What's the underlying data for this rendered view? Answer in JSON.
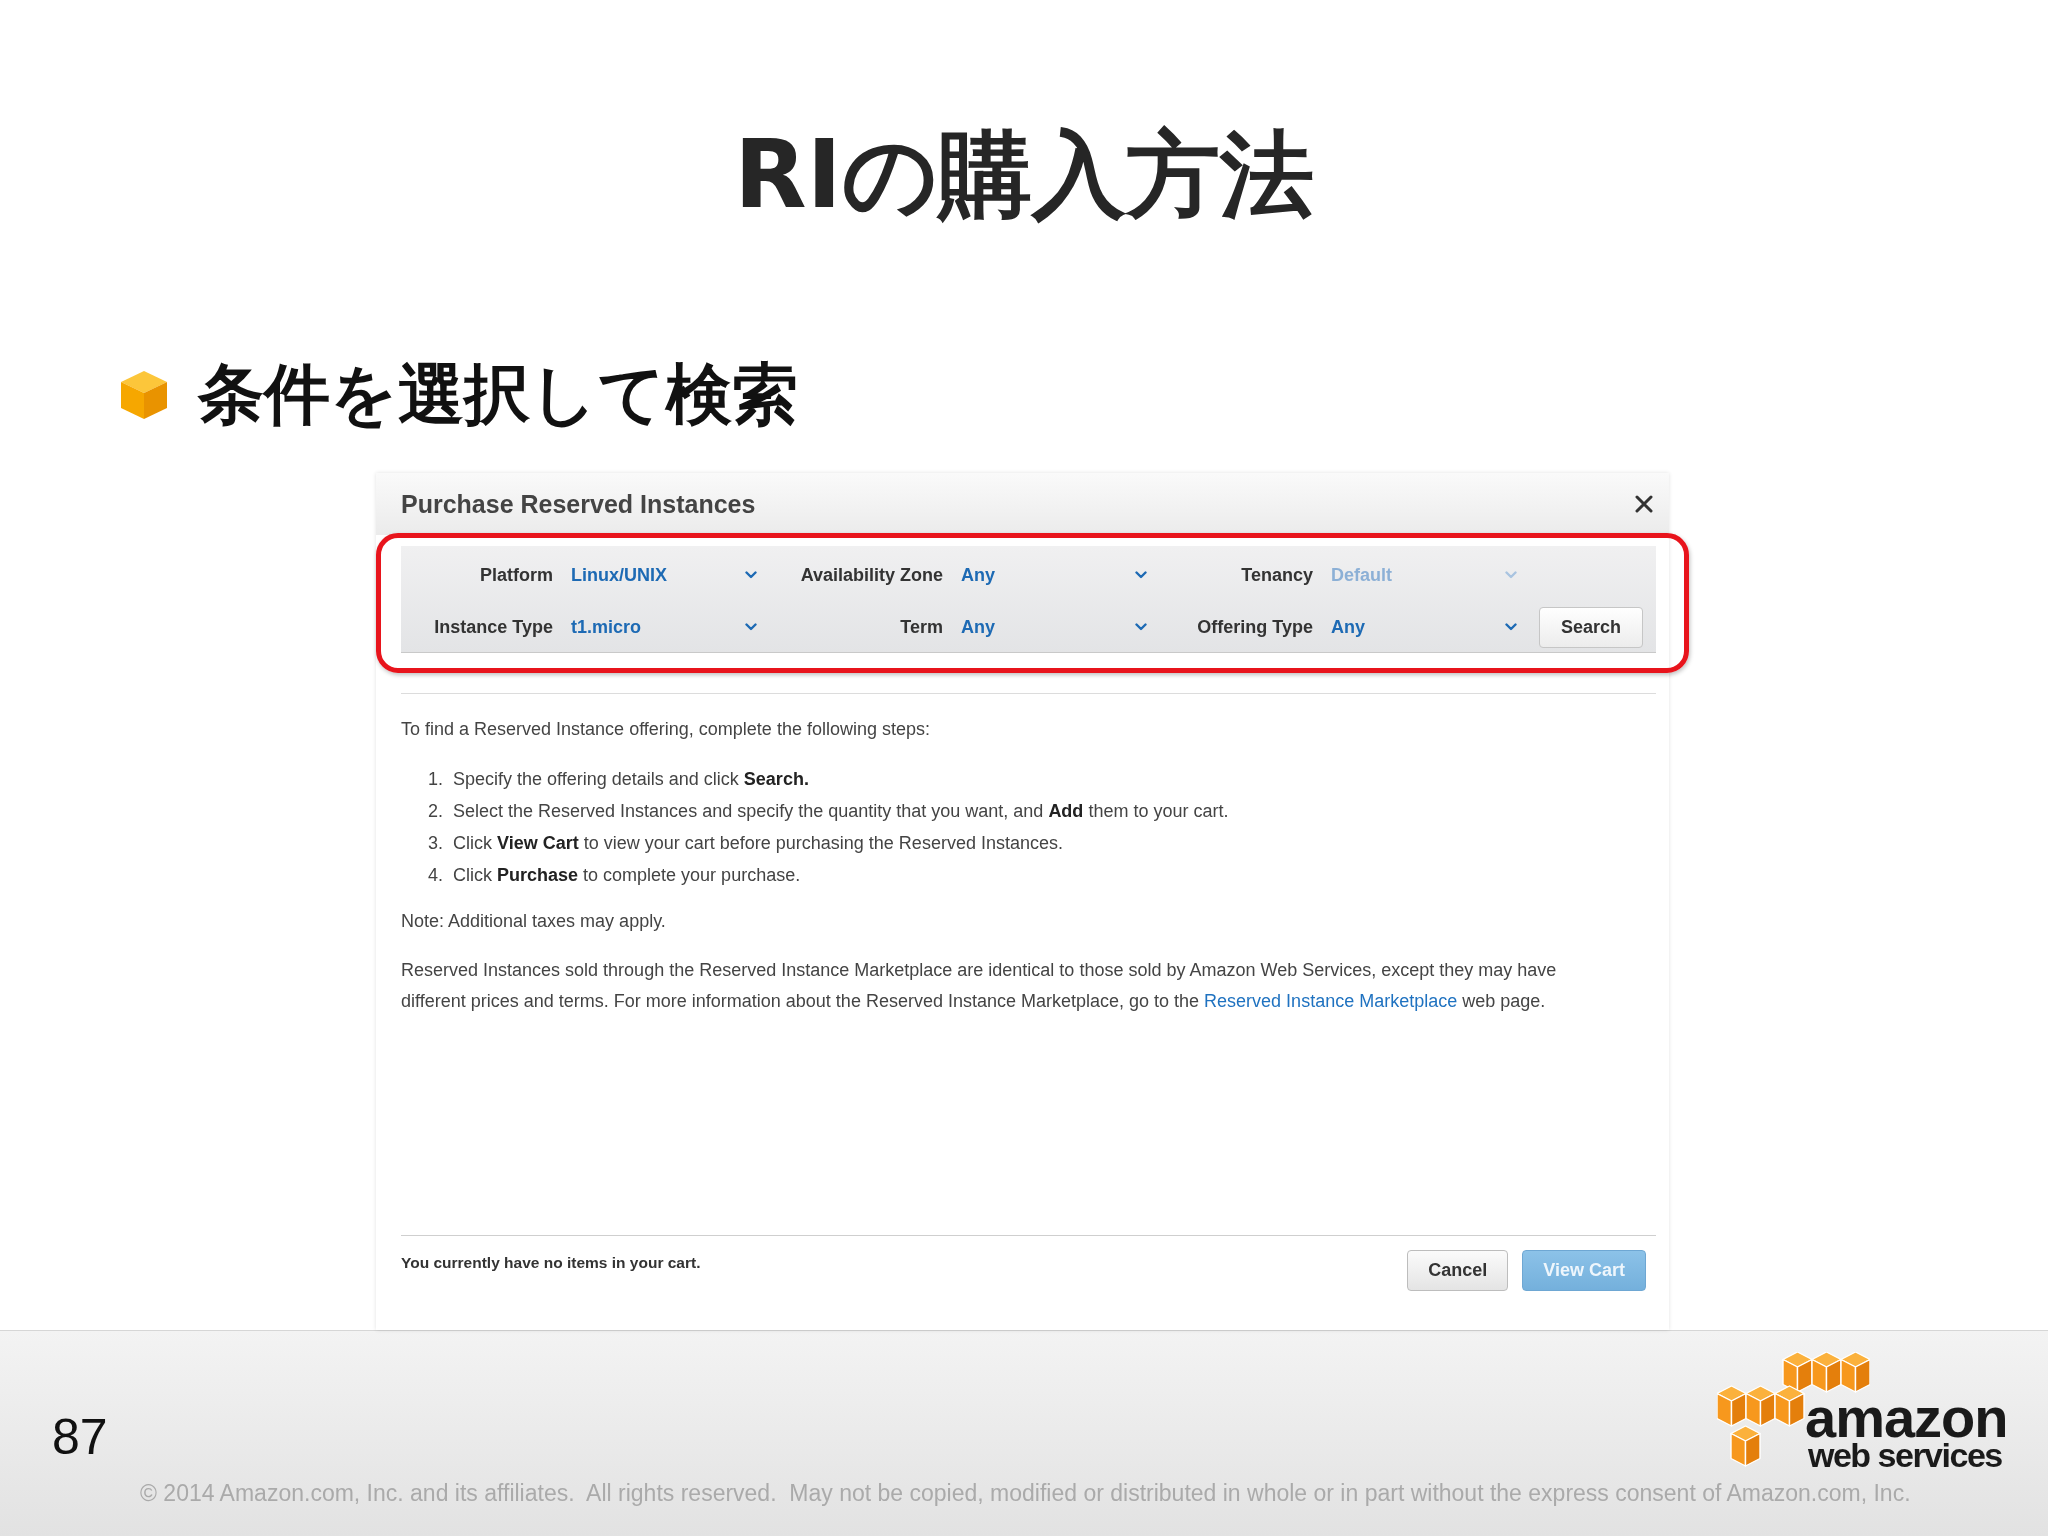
{
  "slide": {
    "title": "RIの購入方法",
    "bullet": "条件を選択して検索",
    "page_number": "87",
    "copyright": "© 2014 Amazon.com, Inc. and its affiliates.  All rights reserved.  May not be copied, modified or distributed in whole or in part without the express consent of Amazon.com, Inc."
  },
  "dialog": {
    "title": "Purchase Reserved Instances",
    "filter_rows": [
      {
        "filters": [
          {
            "label": "Platform",
            "value": "Linux/UNIX",
            "disabled": false
          },
          {
            "label": "Availability Zone",
            "value": "Any",
            "disabled": false
          },
          {
            "label": "Tenancy",
            "value": "Default",
            "disabled": true
          }
        ]
      },
      {
        "filters": [
          {
            "label": "Instance Type",
            "value": "t1.micro",
            "disabled": false
          },
          {
            "label": "Term",
            "value": "Any",
            "disabled": false
          },
          {
            "label": "Offering Type",
            "value": "Any",
            "disabled": false
          }
        ]
      }
    ],
    "search_button": {
      "label": "Search"
    },
    "intro": "To find a Reserved Instance offering, complete the following steps:",
    "steps": [
      {
        "number": "1.",
        "text": "Specify the offering details and click **Search.**"
      },
      {
        "number": "2.",
        "text": "Select the Reserved Instances and specify the quantity that you want, and **Add** them to your cart."
      },
      {
        "number": "3.",
        "text": "Click **View Cart** to view your cart before purchasing the Reserved Instances."
      },
      {
        "number": "4.",
        "text": "Click **Purchase** to complete your purchase."
      }
    ],
    "note": "Note: Additional taxes may apply.",
    "paragraph": {
      "text": "Reserved Instances sold through the Reserved Instance Marketplace are identical to those sold by Amazon Web Services, except they may have different prices and terms. For more information about the Reserved Instance Marketplace, go to the",
      "link": "Reserved Instance Marketplace",
      "after": "web page."
    },
    "cart_message": "You currently have no items in your cart.",
    "buttons": [
      {
        "label": "Cancel",
        "kind": "default",
        "disabled": false
      },
      {
        "label": "View Cart",
        "kind": "primary",
        "disabled": true
      }
    ]
  },
  "logo": {
    "wordmark": "amazon",
    "tagline": "web services"
  }
}
